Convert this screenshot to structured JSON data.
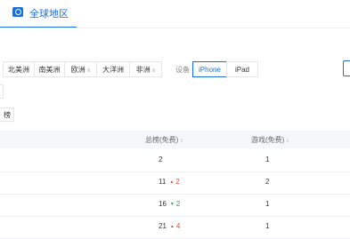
{
  "region_tab": {
    "label": "全球地区",
    "icon": "globe-icon"
  },
  "continents": [
    {
      "label": "北美洲",
      "sortable": false
    },
    {
      "label": "南美洲",
      "sortable": false
    },
    {
      "label": "欧洲",
      "sortable": true
    },
    {
      "label": "大洋洲",
      "sortable": false
    },
    {
      "label": "非洲",
      "sortable": true
    }
  ],
  "sort_glyph": "≡",
  "device": {
    "label": "设备",
    "options": [
      "iPhone",
      "iPad"
    ],
    "selected": "iPhone"
  },
  "rank_type": {
    "label": "榜"
  },
  "table": {
    "columns": [
      {
        "label": "总榜(免费)",
        "sort": "↕"
      },
      {
        "label": "游戏(免费)",
        "sort": "↕"
      }
    ],
    "rows": [
      {
        "total": "2",
        "total_change": "",
        "total_change_dir": "",
        "game": "1"
      },
      {
        "total": "11",
        "total_change": "2",
        "total_change_dir": "up-red",
        "game": "2"
      },
      {
        "total": "16",
        "total_change": "2",
        "total_change_dir": "up-green",
        "game": "1"
      },
      {
        "total": "21",
        "total_change": "4",
        "total_change_dir": "up-red",
        "game": "1"
      }
    ]
  },
  "colors": {
    "accent": "#1e6fd9",
    "up_red": "#e04a3a",
    "up_green": "#2aa34a"
  }
}
